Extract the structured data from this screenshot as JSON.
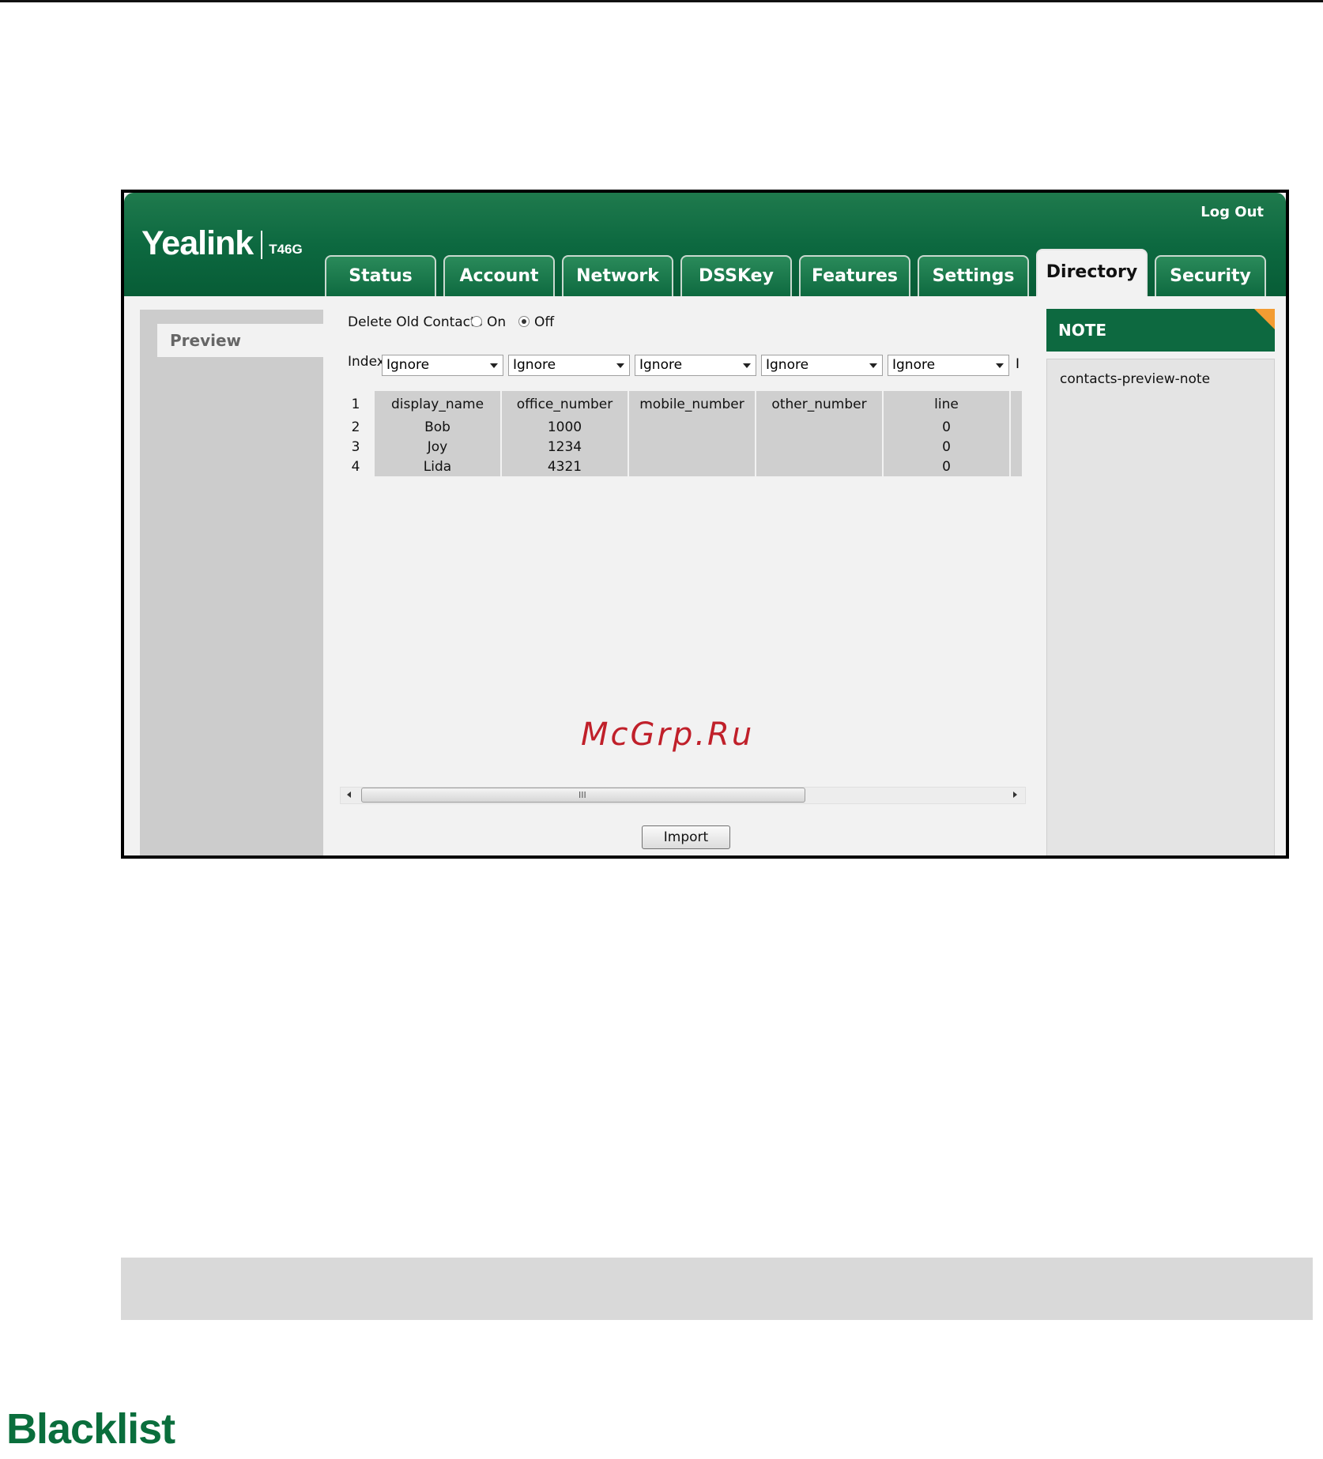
{
  "header": {
    "brand": "Yealink",
    "model": "T46G",
    "logout_label": "Log Out"
  },
  "tabs": [
    {
      "label": "Status",
      "active": false
    },
    {
      "label": "Account",
      "active": false
    },
    {
      "label": "Network",
      "active": false
    },
    {
      "label": "DSSKey",
      "active": false
    },
    {
      "label": "Features",
      "active": false
    },
    {
      "label": "Settings",
      "active": false
    },
    {
      "label": "Directory",
      "active": true
    },
    {
      "label": "Security",
      "active": false
    }
  ],
  "sidebar": {
    "items": [
      {
        "label": "Preview",
        "selected": true
      }
    ]
  },
  "main": {
    "delete_old_contacts_label": "Delete Old Contacts",
    "radio_on_label": "On",
    "radio_off_label": "Off",
    "selected_option": "Off",
    "index_label": "Index",
    "selects": [
      "Ignore",
      "Ignore",
      "Ignore",
      "Ignore",
      "Ignore",
      "I"
    ],
    "table": {
      "header": [
        "1",
        "display_name",
        "office_number",
        "mobile_number",
        "other_number",
        "line"
      ],
      "rows": [
        [
          "2",
          "Bob",
          "1000",
          "",
          "",
          "0"
        ],
        [
          "3",
          "Joy",
          "1234",
          "",
          "",
          "0"
        ],
        [
          "4",
          "Lida",
          "4321",
          "",
          "",
          "0"
        ]
      ]
    },
    "scroll_grip": "III",
    "import_label": "Import"
  },
  "watermark": "McGrp.Ru",
  "note": {
    "title": "NOTE",
    "text": "contacts-preview-note"
  },
  "page": {
    "section_title": "Blacklist"
  },
  "colors": {
    "brand_green": "#0d6940",
    "note_corner": "#f39c32",
    "watermark_red": "#c0202a"
  }
}
